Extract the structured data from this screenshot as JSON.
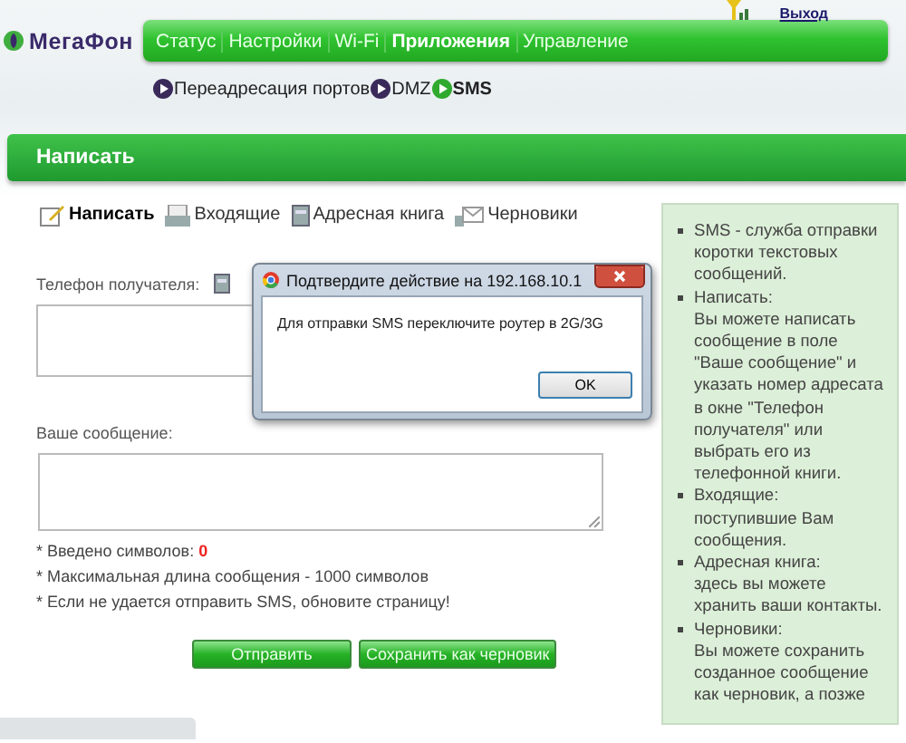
{
  "header": {
    "logo": "МегаФон",
    "logout": "Выход",
    "nav": [
      {
        "label": "Статус",
        "selected": false
      },
      {
        "label": "Настройки",
        "selected": false
      },
      {
        "label": "Wi-Fi",
        "selected": false
      },
      {
        "label": "Приложения",
        "selected": true
      },
      {
        "label": "Управление",
        "selected": false
      }
    ],
    "subnav": [
      {
        "label": "Переадресация портов",
        "selected": false
      },
      {
        "label": "DMZ",
        "selected": false
      },
      {
        "label": "SMS",
        "selected": true
      }
    ]
  },
  "page_title": "Написать",
  "tabs": [
    {
      "label": "Написать",
      "selected": true
    },
    {
      "label": "Входящие",
      "selected": false
    },
    {
      "label": "Адресная книга",
      "selected": false
    },
    {
      "label": "Черновики",
      "selected": false
    }
  ],
  "form": {
    "recipient_label": "Телефон получателя:",
    "message_label": "Ваше сообщение:",
    "char_count": {
      "label": "* Введено символов:",
      "value": "0"
    },
    "notes": [
      "* Максимальная длина сообщения - 1000 символов",
      "* Если не удается отправить SMS, обновите страницу!"
    ],
    "buttons": [
      "Отправить",
      "Сохранить как черновик"
    ]
  },
  "help": [
    {
      "text": "SMS - служба отправки коротки текстовых сообщений."
    },
    {
      "title": "Написать:",
      "text": "Вы можете написать сообщение в поле \"Ваше сообщение\" и указать номер адресата в окне \"Телефон получателя\" или выбрать его из телефонной книги."
    },
    {
      "title": "Входящие:",
      "text": "поступившие Вам сообщения."
    },
    {
      "title": "Адресная книга:",
      "text": "здесь вы можете хранить ваши контакты."
    },
    {
      "title": "Черновики:",
      "text": "Вы можете сохранить созданное сообщение как черновик, а позже"
    }
  ],
  "dialog": {
    "title": "Подтвердите действие на 192.168.10.1",
    "message": "Для отправки SMS переключите роутер в 2G/3G",
    "button": "OK"
  }
}
